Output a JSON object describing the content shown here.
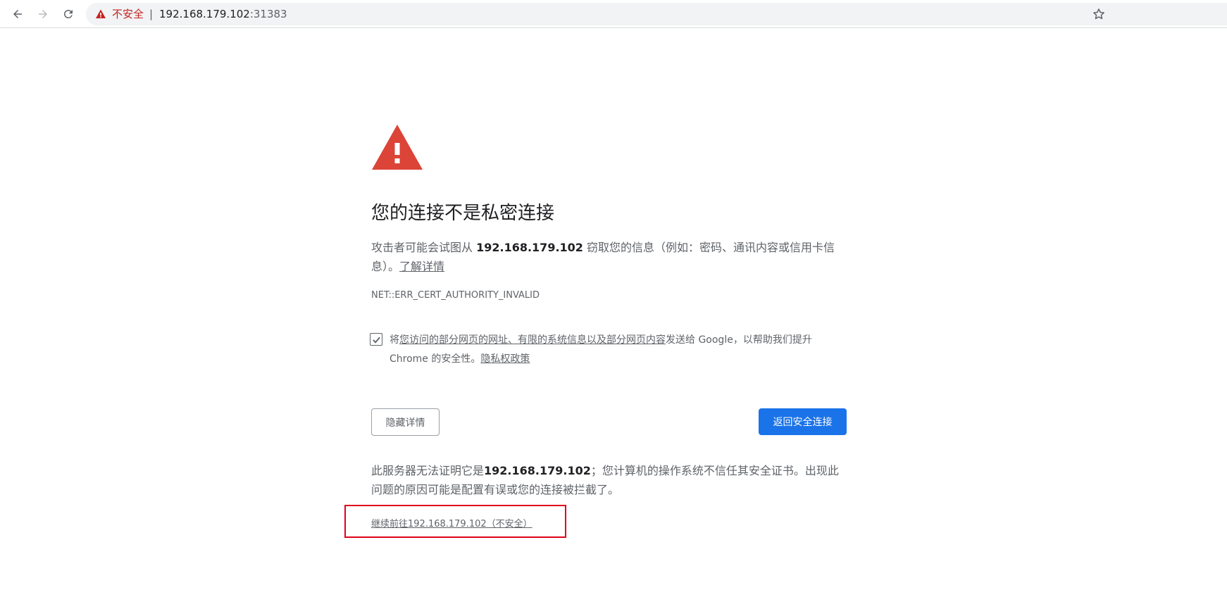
{
  "browser": {
    "omnibox": {
      "security_label": "不安全",
      "separator": "|",
      "host": "192.168.179.102",
      "port": ":31383"
    },
    "colors": {
      "danger": "#c5221f",
      "primary_button": "#1a73e8",
      "annotation_box": "#e0001b"
    }
  },
  "interstitial": {
    "icon": "warning-triangle-icon",
    "heading": "您的连接不是私密连接",
    "explanation": {
      "before": "攻击者可能会试图从 ",
      "host": "192.168.179.102",
      "after": " 窃取您的信息（例如：密码、通讯内容或信用卡信息）。",
      "learn_more": "了解详情"
    },
    "error_code": "NET::ERR_CERT_AUTHORITY_INVALID",
    "optin": {
      "checked": true,
      "prefix": "将",
      "link1": "您访问的部分网页的网址、有限的系统信息以及部分网页内容",
      "middle": "发送给 Google，以帮助我们提升 Chrome 的安全性。",
      "privacy_link": "隐私权政策"
    },
    "buttons": {
      "details": "隐藏详情",
      "back_to_safety": "返回安全连接"
    },
    "details": {
      "before": "此服务器无法证明它是",
      "host": "192.168.179.102",
      "after": "；您计算机的操作系统不信任其安全证书。出现此问题的原因可能是配置有误或您的连接被拦截了。"
    },
    "proceed_link": "继续前往192.168.179.102（不安全）"
  }
}
